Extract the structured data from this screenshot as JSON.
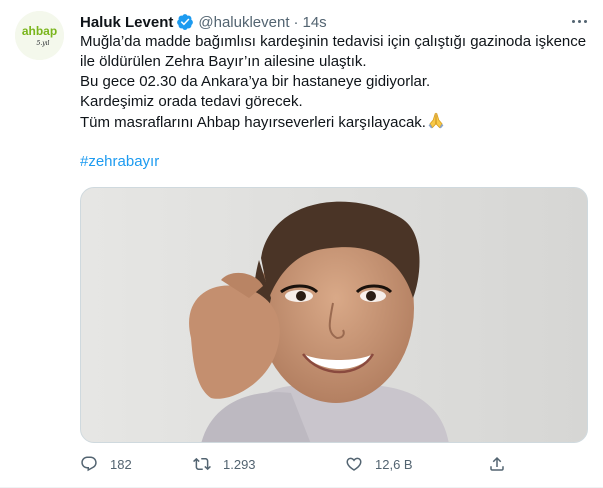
{
  "author": {
    "display_name": "Haluk Levent",
    "handle": "@haluklevent",
    "separator": "·",
    "timestamp": "14s",
    "avatar_icon": "ahbap-logo-icon",
    "avatar_text": "ahbap",
    "avatar_subtext": "5.yıl"
  },
  "tweet": {
    "lines": [
      "Muğla’da madde bağımlısı kardeşinin tedavisi için çalıştığı gazinoda işkence",
      "ile öldürülen Zehra Bayır’ın ailesine ulaştık.",
      "Bu gece 02.30 da Ankara’ya bir hastaneye  gidiyorlar.",
      "Kardeşimiz orada tedavi görecek.",
      "Tüm masraflarını Ahbap hayırseverleri karşılayacak."
    ],
    "emoji_icon": "folded-hands-icon",
    "hashtag": "#zehrabayır"
  },
  "actions": {
    "reply_count": "182",
    "retweet_count": "1.293",
    "like_count": "12,6 B",
    "icons": [
      "reply-icon",
      "retweet-icon",
      "like-icon",
      "share-icon"
    ]
  },
  "colors": {
    "accent": "#1d9bf0",
    "text": "#0f1419",
    "secondary": "#536471",
    "ahbap_green": "#7ab51d"
  }
}
